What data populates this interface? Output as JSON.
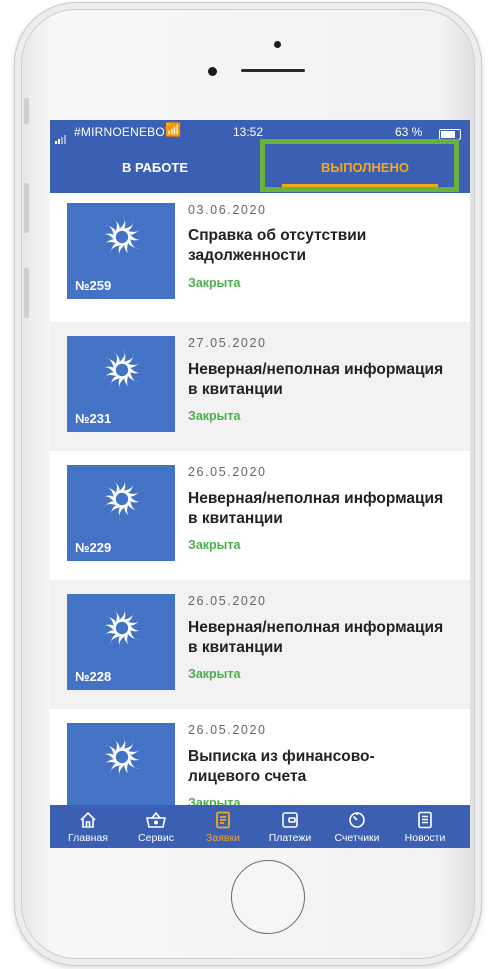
{
  "status_bar": {
    "carrier": "#MIRNOENEBO75",
    "time": "13:52",
    "battery": "63 %"
  },
  "tabs": [
    {
      "label": "В РАБОТЕ",
      "active": false
    },
    {
      "label": "ВЫПОЛНЕНО",
      "active": true
    }
  ],
  "colors": {
    "header": "#3b5fb3",
    "accent": "#f4a81d",
    "highlight_box": "#69b23c",
    "status_closed": "#4cae4c",
    "thumbnail": "#4472c4"
  },
  "requests": [
    {
      "number": "№259",
      "date": "03.06.2020",
      "title_lines": [
        "Справка об отсутствии",
        "задолженности"
      ],
      "status": "Закрыта"
    },
    {
      "number": "№231",
      "date": "27.05.2020",
      "title_lines": [
        "Неверная/неполная информация",
        "в квитанции"
      ],
      "status": "Закрыта"
    },
    {
      "number": "№229",
      "date": "26.05.2020",
      "title_lines": [
        "Неверная/неполная информация",
        "в квитанции"
      ],
      "status": "Закрыта"
    },
    {
      "number": "№228",
      "date": "26.05.2020",
      "title_lines": [
        "Неверная/неполная информация",
        "в квитанции"
      ],
      "status": "Закрыта"
    },
    {
      "number": "",
      "date": "26.05.2020",
      "title_lines": [
        "Выписка из финансово-",
        "лицевого счета"
      ],
      "status": "Закрыта"
    }
  ],
  "bottom_nav": [
    {
      "label": "Главная",
      "icon": "home-icon",
      "active": false
    },
    {
      "label": "Сервис",
      "icon": "basket-icon",
      "active": false
    },
    {
      "label": "Заявки",
      "icon": "document-icon",
      "active": true
    },
    {
      "label": "Платежи",
      "icon": "wallet-icon",
      "active": false
    },
    {
      "label": "Счетчики",
      "icon": "meter-icon",
      "active": false
    },
    {
      "label": "Новости",
      "icon": "news-icon",
      "active": false
    }
  ]
}
